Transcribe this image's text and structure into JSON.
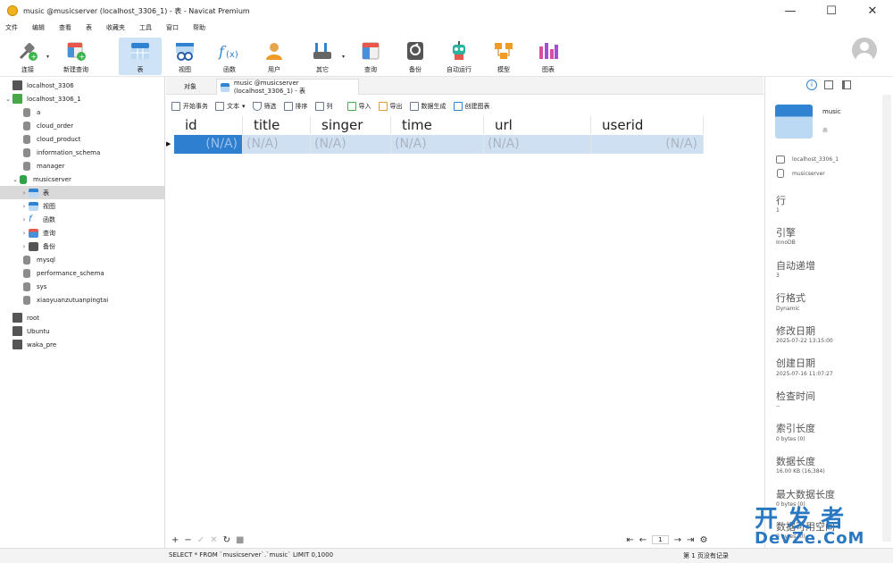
{
  "window": {
    "title": "music @musicserver (localhost_3306_1) - 表 - Navicat Premium",
    "minimize": "—",
    "maximize": "☐",
    "close": "✕"
  },
  "menu": [
    "文件",
    "编辑",
    "查看",
    "表",
    "收藏夹",
    "工具",
    "窗口",
    "帮助"
  ],
  "toolbar": {
    "connect": "连接",
    "new_query": "新建查询",
    "table": "表",
    "view": "视图",
    "function": "函数",
    "user": "用户",
    "other": "其它",
    "query": "查询",
    "backup": "备份",
    "automation": "自动运行",
    "model": "模型",
    "chart": "图表"
  },
  "sidebar": {
    "items": [
      {
        "label": "localhost_3306"
      },
      {
        "label": "localhost_3306_1"
      },
      {
        "label": "a"
      },
      {
        "label": "cloud_order"
      },
      {
        "label": "cloud_product"
      },
      {
        "label": "information_schema"
      },
      {
        "label": "manager"
      },
      {
        "label": "musicserver"
      },
      {
        "label": "表"
      },
      {
        "label": "视图"
      },
      {
        "label": "函数"
      },
      {
        "label": "查询"
      },
      {
        "label": "备份"
      },
      {
        "label": "mysql"
      },
      {
        "label": "performance_schema"
      },
      {
        "label": "sys"
      },
      {
        "label": "xiaoyuanzutuanpingtai"
      },
      {
        "label": "root"
      },
      {
        "label": "Ubuntu"
      },
      {
        "label": "waka_pre"
      }
    ]
  },
  "tabs": {
    "objects": "对象",
    "active": "music @musicserver (localhost_3306_1) - 表"
  },
  "object_toolbar": {
    "begin_transaction": "开始事务",
    "text": "文本",
    "filter": "筛选",
    "sort": "排序",
    "columns": "列",
    "import": "导入",
    "export": "导出",
    "data_generation": "数据生成",
    "create_chart": "创建图表"
  },
  "grid": {
    "columns": [
      "id",
      "title",
      "singer",
      "time",
      "url",
      "userid"
    ],
    "row": [
      "(N/A)",
      "(N/A)",
      "(N/A)",
      "(N/A)",
      "(N/A)",
      "(N/A)"
    ]
  },
  "bottom": {
    "add": "+",
    "remove": "−",
    "apply": "✓",
    "discard": "✕",
    "refresh": "↻",
    "stop": "■",
    "page": "1",
    "first": "⇤",
    "prev": "←",
    "next": "→",
    "last": "⇥",
    "settings": "⚙"
  },
  "status": {
    "sql": "SELECT * FROM `musicserver`.`music` LIMIT 0,1000",
    "records": "第 1 页没有记录"
  },
  "info_panel": {
    "table_name": "music",
    "table_type": "表",
    "connection": "localhost_3306_1",
    "database": "musicserver",
    "rows_label": "行",
    "rows_value": "1",
    "engine_label": "引擎",
    "engine_value": "InnoDB",
    "auto_inc_label": "自动递增",
    "auto_inc_value": "3",
    "row_format_label": "行格式",
    "row_format_value": "Dynamic",
    "modified_label": "修改日期",
    "modified_value": "2025-07-22 13:15:00",
    "created_label": "创建日期",
    "created_value": "2025-07-16 11:07:27",
    "check_time_label": "检查时间",
    "check_time_value": "--",
    "index_len_label": "索引长度",
    "index_len_value": "0 bytes (0)",
    "data_len_label": "数据长度",
    "data_len_value": "16.00 KB (16,384)",
    "max_data_len_label": "最大数据长度",
    "max_data_len_value": "0 bytes (0)",
    "free_label": "数据可用空间",
    "free_value": "0 bytes (0)"
  },
  "watermark": {
    "line1": "开 发 者",
    "line2": "DevZe.CoM"
  }
}
